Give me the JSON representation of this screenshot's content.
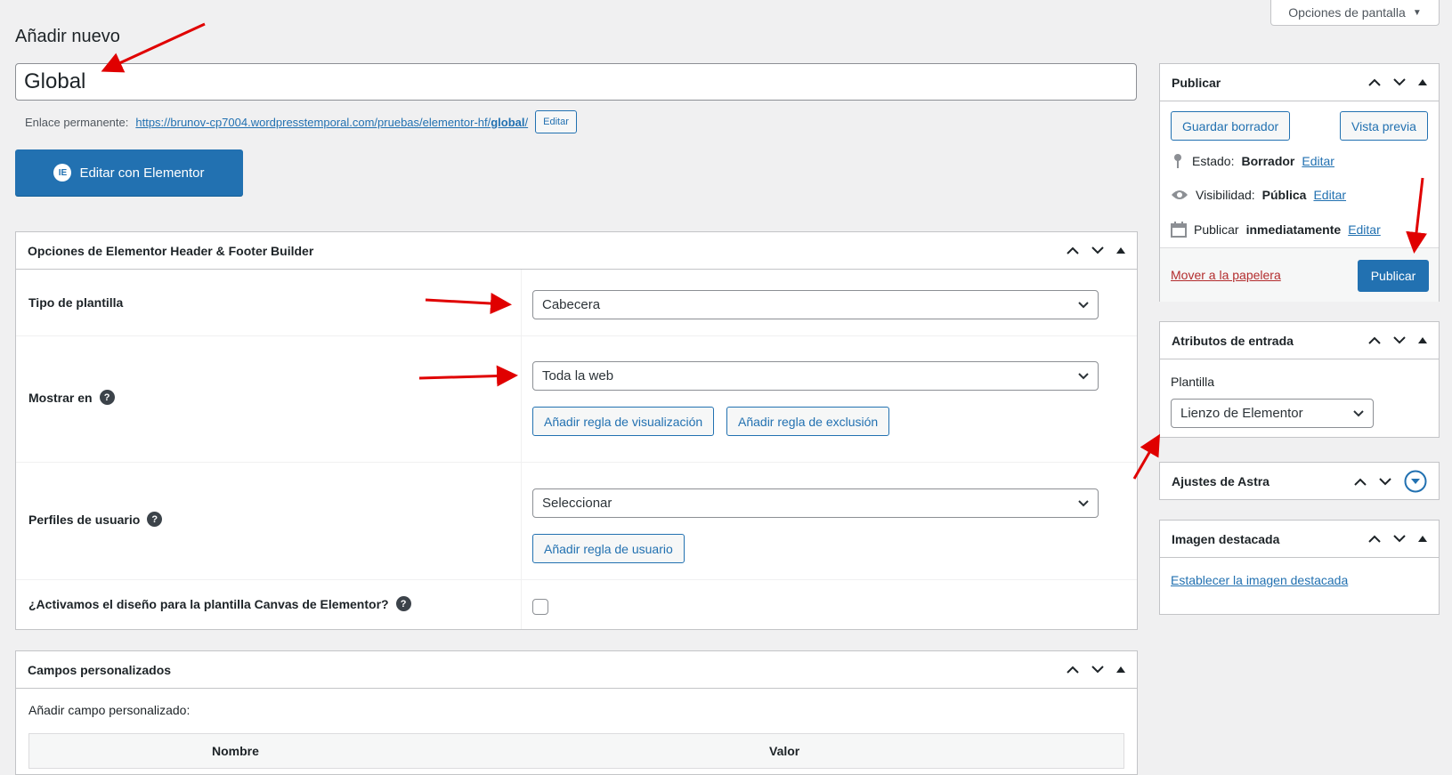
{
  "screen_options": {
    "label": "Opciones de pantalla"
  },
  "page_title": "Añadir nuevo",
  "post_title": "Global",
  "permalink": {
    "label": "Enlace permanente:",
    "url_base": "https://brunov-cp7004.wordpresstemporal.com/pruebas/elementor-hf/",
    "slug": "global",
    "url_end": "/",
    "edit_label": "Editar"
  },
  "elementor_button": {
    "icon_glyph": "IE",
    "label": "Editar con Elementor"
  },
  "hf_box": {
    "title": "Opciones de Elementor Header & Footer Builder",
    "template_type_label": "Tipo de plantilla",
    "template_type_value": "Cabecera",
    "show_on_label": "Mostrar en",
    "show_on_value": "Toda la web",
    "add_display_rule": "Añadir regla de visualización",
    "add_exclusion_rule": "Añadir regla de exclusión",
    "user_roles_label": "Perfiles de usuario",
    "user_roles_value": "Seleccionar",
    "add_user_rule": "Añadir regla de usuario",
    "canvas_label": "¿Activamos el diseño para la plantilla Canvas de Elementor?",
    "canvas_checked": false,
    "help_glyph": "?"
  },
  "custom_fields": {
    "title": "Campos personalizados",
    "add_label": "Añadir campo personalizado:",
    "col_name": "Nombre",
    "col_value": "Valor"
  },
  "publish_box": {
    "title": "Publicar",
    "save_draft": "Guardar borrador",
    "preview": "Vista previa",
    "status_label": "Estado:",
    "status_value": "Borrador",
    "visibility_label": "Visibilidad:",
    "visibility_value": "Pública",
    "publish_label": "Publicar",
    "publish_value": "inmediatamente",
    "edit_link": "Editar",
    "trash": "Mover a la papelera",
    "publish_button": "Publicar"
  },
  "attributes_box": {
    "title": "Atributos de entrada",
    "template_label": "Plantilla",
    "template_value": "Lienzo de Elementor"
  },
  "astra_box": {
    "title": "Ajustes de Astra"
  },
  "featured_box": {
    "title": "Imagen destacada",
    "link": "Establecer la imagen destacada"
  },
  "colors": {
    "accent": "#2271b1",
    "annotation_arrow": "#e00000",
    "trash": "#b32d2e"
  }
}
